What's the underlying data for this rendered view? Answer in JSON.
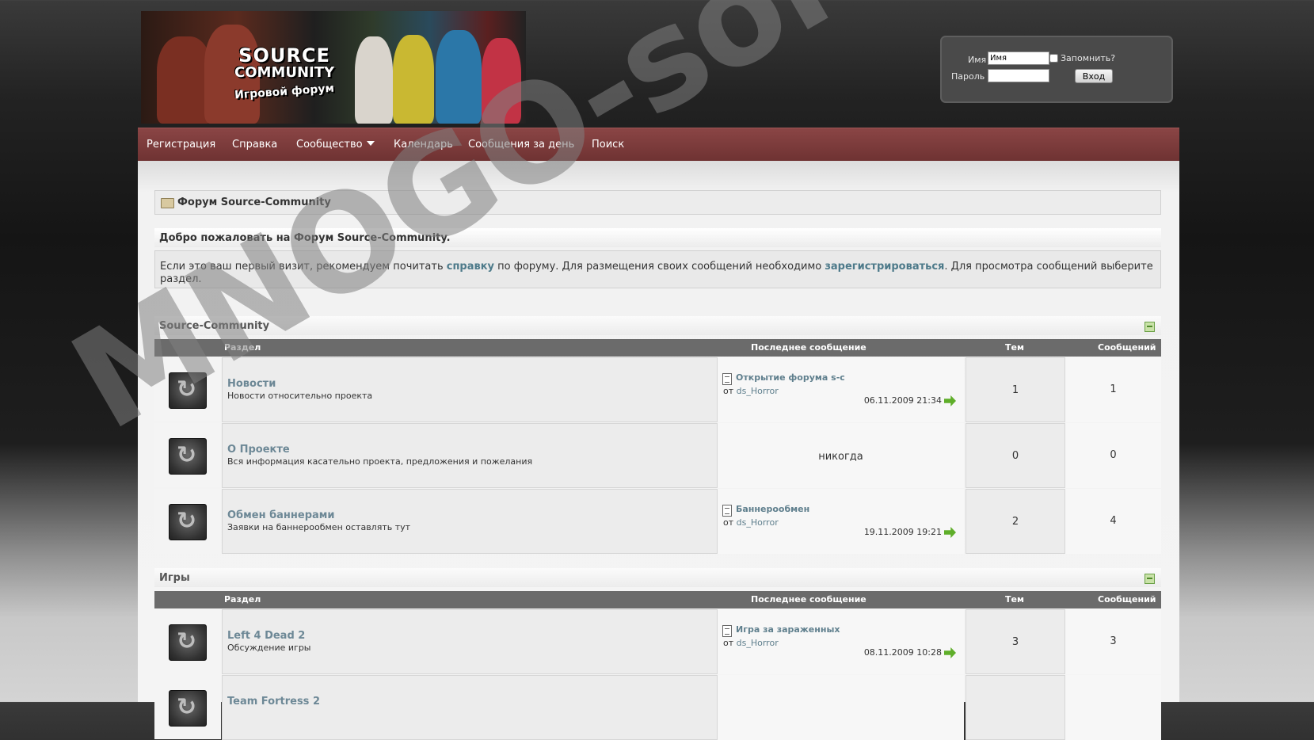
{
  "header": {
    "logo": {
      "line1": "SOURCE",
      "line2": "COMMUNITY",
      "line3": "Игровой форум"
    },
    "login": {
      "username_label": "Имя",
      "username_placeholder": "Имя",
      "remember_label": "Запомнить?",
      "password_label": "Пароль",
      "submit_label": "Вход"
    }
  },
  "nav": {
    "items": [
      "Регистрация",
      "Справка",
      "Сообщество",
      "Календарь",
      "Сообщения за день",
      "Поиск"
    ]
  },
  "breadcrumb": "Форум Source-Community",
  "welcome": {
    "title": "Добро пожаловать на Форум Source-Community.",
    "text_before": "Если это ваш первый визит, рекомендуем почитать ",
    "link_help": "справку",
    "text_mid": " по форуму. Для размещения своих сообщений необходимо ",
    "link_register": "зарегистрироваться",
    "text_after": ". Для просмотра сообщений выберите раздел."
  },
  "columns": {
    "section": "Раздел",
    "last_post": "Последнее сообщение",
    "topics": "Тем",
    "posts": "Сообщений"
  },
  "categories": [
    {
      "name": "Source-Community",
      "forums": [
        {
          "title": "Новости",
          "desc": "Новости относительно проекта",
          "last_title": "Открытие форума s-c",
          "by_prefix": "от",
          "last_user": "ds_Horror",
          "last_date": "06.11.2009 21:34",
          "topics": "1",
          "posts": "1"
        },
        {
          "title": "О Проекте",
          "desc": "Вся информация касательно проекта, предложения и пожелания",
          "never": "никогда",
          "topics": "0",
          "posts": "0"
        },
        {
          "title": "Обмен баннерами",
          "desc": "Заявки на баннерообмен оставлять тут",
          "last_title": "Баннерообмен",
          "by_prefix": "от",
          "last_user": "ds_Horror",
          "last_date": "19.11.2009 19:21",
          "topics": "2",
          "posts": "4"
        }
      ]
    },
    {
      "name": "Игры",
      "forums": [
        {
          "title": "Left 4 Dead 2",
          "desc": "Обсуждение игры",
          "last_title": "Игра за зараженных",
          "by_prefix": "от",
          "last_user": "ds_Horror",
          "last_date": "08.11.2009 10:28",
          "topics": "3",
          "posts": "3"
        },
        {
          "title": "Team Fortress 2"
        }
      ]
    }
  ],
  "watermark": "MNOGO-softa.ru",
  "colors": {
    "navbar": "#7a3a3a",
    "link": "#6d8896",
    "table_header": "#6b6b6b",
    "go_arrow": "#5fae2a"
  }
}
